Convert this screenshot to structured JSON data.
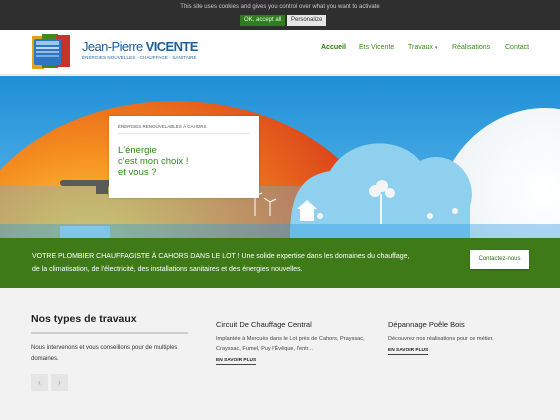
{
  "cookie": {
    "message": "This site uses cookies and gives you control over what you want to activate",
    "ok_label": "OK, accept all",
    "personalize_label": "Personalize"
  },
  "brand": {
    "name_first": "Jean-Pierre",
    "name_last": "VICENTE",
    "tagline": "ÉNERGIES NOUVELLES  -  CHAUFFAGE  -  SANITAIRE"
  },
  "nav": {
    "items": [
      {
        "label": "Accueil"
      },
      {
        "label": "Ets Vicente"
      },
      {
        "label": "Travaux"
      },
      {
        "label": "Réalisations"
      },
      {
        "label": "Contact"
      }
    ]
  },
  "hero": {
    "kicker": "ÉNERGIES RENOUVELABLES À CAHORS",
    "headline": "L'énergie\nc'est mon choix !\net vous ?"
  },
  "banner": {
    "text": "VOTRE PLOMBIER CHAUFFAGISTE À CAHORS DANS LE LOT ! Une solide expertise dans les domaines du chauffage, de la climatisation, de l'électricité, des installations sanitaires et des énergies nouvelles.",
    "button_label": "Contactez-nous"
  },
  "services": {
    "title": "Nos types de travaux",
    "text": "Nous intervenons et vous conseillons pour de multiples domaines.",
    "cards": [
      {
        "title": "Circuit De Chauffage Central",
        "text": "Implantée à Mercuès dans le Lot près de Cahors, Prayssac, Crayssac, Fumel, Puy l'Évêque, l'entr...",
        "link": "EN SAVOIR PLUS"
      },
      {
        "title": "Dépannage Poêle Bois",
        "text": "Découvrez nos réalisations pour ce métier.",
        "link": "EN SAVOIR PLUS"
      }
    ]
  },
  "icons": {
    "prev": "chevron-left-icon",
    "next": "chevron-right-icon",
    "caret": "chevron-down-icon"
  },
  "colors": {
    "accent_green": "#3f7a19",
    "nav_green": "#3b8a1d",
    "brand_blue": "#1d5f9a"
  }
}
